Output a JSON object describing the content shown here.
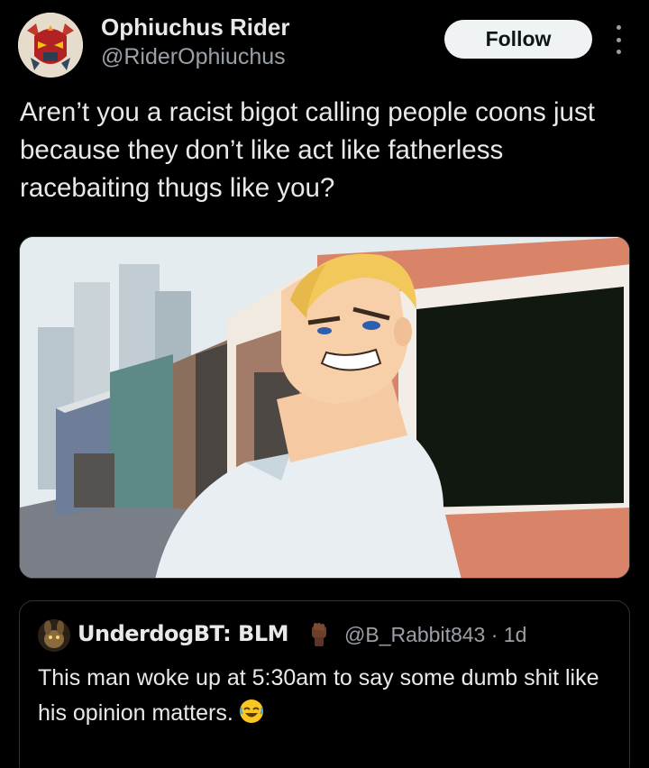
{
  "author": {
    "name": "Ophiuchus Rider",
    "handle": "@RiderOphiuchus",
    "avatar_icon": "robot-mask-avatar"
  },
  "actions": {
    "follow_label": "Follow",
    "more_icon": "vertical-ellipsis-icon"
  },
  "tweet": {
    "text": "Aren’t you a racist bigot calling people coons just because they don’t like act like fatherless racebaiting thugs like you?"
  },
  "media": {
    "kind": "cartoon-image",
    "description_icon": "smug-cartoon-man-image"
  },
  "quoted": {
    "display_name": "UnderdogBT: BLM",
    "name_emoji": "raised-fist-icon",
    "handle": "@B_Rabbit843",
    "separator": "·",
    "time": "1d",
    "text": "This man woke up at 5:30am to say some dumb shit like his opinion matters.",
    "trailing_emoji": "rolling-on-floor-laughing-icon"
  },
  "colors": {
    "background": "#000000",
    "text_primary": "#e7e9ea",
    "text_secondary": "#9aa0a6",
    "border": "#2f3336",
    "follow_bg": "#eff3f4"
  }
}
